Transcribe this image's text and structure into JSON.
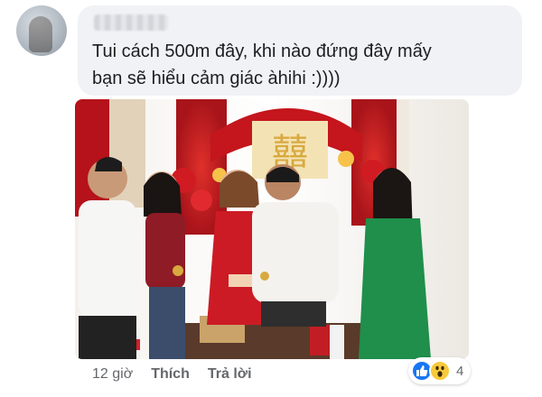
{
  "comment": {
    "text": "Tui cách 500m đây, khi nào đứng đây mấy\nbạn sẽ hiểu cảm giác àhihi :))))"
  },
  "footer": {
    "time": "12 giờ",
    "like_label": "Thích",
    "reply_label": "Trả lời"
  },
  "reactions": {
    "count": "4",
    "icons": [
      "like-icon",
      "wow-icon"
    ]
  },
  "colors": {
    "bubble_bg": "#f0f2f5",
    "text": "#1c1e21",
    "meta": "#65676b",
    "like_blue": "#1877f2",
    "wow_yellow": "#f7c93b"
  }
}
